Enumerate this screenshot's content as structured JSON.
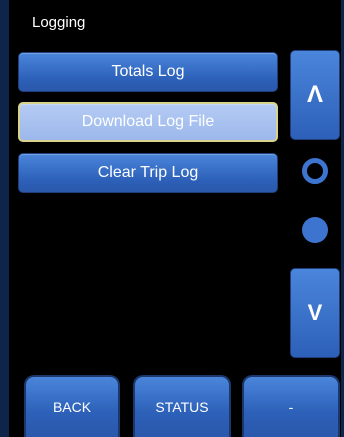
{
  "header": {
    "title": "Logging"
  },
  "menu": {
    "items": [
      {
        "label": "Totals Log",
        "selected": false
      },
      {
        "label": "Download Log File",
        "selected": true
      },
      {
        "label": "Clear Trip Log",
        "selected": false
      }
    ]
  },
  "scroll": {
    "up_symbol": "Λ",
    "down_symbol": "V",
    "page_indicator": {
      "pages": 2,
      "current": 1
    }
  },
  "nav": {
    "back_label": "BACK",
    "status_label": "STATUS",
    "third_label": "-"
  },
  "colors": {
    "button_blue": "#2d60b8",
    "selected_button": "#9cb8ec",
    "selected_border": "#d8d38a",
    "background": "#000000"
  }
}
